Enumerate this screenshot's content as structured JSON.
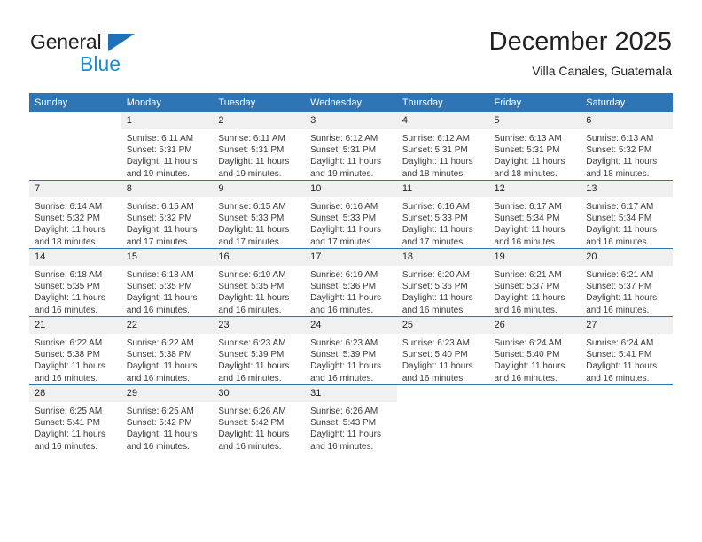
{
  "brand": {
    "name_part1": "General",
    "name_part2": "Blue",
    "triangle_icon": "triangle-icon",
    "accent_color": "#1d8bd1",
    "triangle_color": "#1d71b8"
  },
  "header": {
    "title": "December 2025",
    "subtitle": "Villa Canales, Guatemala"
  },
  "theme": {
    "header_row_bg": "#2e75b6",
    "daynum_bg": "#f0f0f0",
    "row_rule": "#2e75b6",
    "text": "#231f20"
  },
  "columns": [
    "Sunday",
    "Monday",
    "Tuesday",
    "Wednesday",
    "Thursday",
    "Friday",
    "Saturday"
  ],
  "weeks": [
    [
      {
        "day": "",
        "sunrise": "",
        "sunset": "",
        "daylight": "",
        "empty": true
      },
      {
        "day": "1",
        "sunrise": "Sunrise: 6:11 AM",
        "sunset": "Sunset: 5:31 PM",
        "daylight": "Daylight: 11 hours and 19 minutes."
      },
      {
        "day": "2",
        "sunrise": "Sunrise: 6:11 AM",
        "sunset": "Sunset: 5:31 PM",
        "daylight": "Daylight: 11 hours and 19 minutes."
      },
      {
        "day": "3",
        "sunrise": "Sunrise: 6:12 AM",
        "sunset": "Sunset: 5:31 PM",
        "daylight": "Daylight: 11 hours and 19 minutes."
      },
      {
        "day": "4",
        "sunrise": "Sunrise: 6:12 AM",
        "sunset": "Sunset: 5:31 PM",
        "daylight": "Daylight: 11 hours and 18 minutes."
      },
      {
        "day": "5",
        "sunrise": "Sunrise: 6:13 AM",
        "sunset": "Sunset: 5:31 PM",
        "daylight": "Daylight: 11 hours and 18 minutes."
      },
      {
        "day": "6",
        "sunrise": "Sunrise: 6:13 AM",
        "sunset": "Sunset: 5:32 PM",
        "daylight": "Daylight: 11 hours and 18 minutes."
      }
    ],
    [
      {
        "day": "7",
        "sunrise": "Sunrise: 6:14 AM",
        "sunset": "Sunset: 5:32 PM",
        "daylight": "Daylight: 11 hours and 18 minutes."
      },
      {
        "day": "8",
        "sunrise": "Sunrise: 6:15 AM",
        "sunset": "Sunset: 5:32 PM",
        "daylight": "Daylight: 11 hours and 17 minutes."
      },
      {
        "day": "9",
        "sunrise": "Sunrise: 6:15 AM",
        "sunset": "Sunset: 5:33 PM",
        "daylight": "Daylight: 11 hours and 17 minutes."
      },
      {
        "day": "10",
        "sunrise": "Sunrise: 6:16 AM",
        "sunset": "Sunset: 5:33 PM",
        "daylight": "Daylight: 11 hours and 17 minutes."
      },
      {
        "day": "11",
        "sunrise": "Sunrise: 6:16 AM",
        "sunset": "Sunset: 5:33 PM",
        "daylight": "Daylight: 11 hours and 17 minutes."
      },
      {
        "day": "12",
        "sunrise": "Sunrise: 6:17 AM",
        "sunset": "Sunset: 5:34 PM",
        "daylight": "Daylight: 11 hours and 16 minutes."
      },
      {
        "day": "13",
        "sunrise": "Sunrise: 6:17 AM",
        "sunset": "Sunset: 5:34 PM",
        "daylight": "Daylight: 11 hours and 16 minutes."
      }
    ],
    [
      {
        "day": "14",
        "sunrise": "Sunrise: 6:18 AM",
        "sunset": "Sunset: 5:35 PM",
        "daylight": "Daylight: 11 hours and 16 minutes."
      },
      {
        "day": "15",
        "sunrise": "Sunrise: 6:18 AM",
        "sunset": "Sunset: 5:35 PM",
        "daylight": "Daylight: 11 hours and 16 minutes."
      },
      {
        "day": "16",
        "sunrise": "Sunrise: 6:19 AM",
        "sunset": "Sunset: 5:35 PM",
        "daylight": "Daylight: 11 hours and 16 minutes."
      },
      {
        "day": "17",
        "sunrise": "Sunrise: 6:19 AM",
        "sunset": "Sunset: 5:36 PM",
        "daylight": "Daylight: 11 hours and 16 minutes."
      },
      {
        "day": "18",
        "sunrise": "Sunrise: 6:20 AM",
        "sunset": "Sunset: 5:36 PM",
        "daylight": "Daylight: 11 hours and 16 minutes."
      },
      {
        "day": "19",
        "sunrise": "Sunrise: 6:21 AM",
        "sunset": "Sunset: 5:37 PM",
        "daylight": "Daylight: 11 hours and 16 minutes."
      },
      {
        "day": "20",
        "sunrise": "Sunrise: 6:21 AM",
        "sunset": "Sunset: 5:37 PM",
        "daylight": "Daylight: 11 hours and 16 minutes."
      }
    ],
    [
      {
        "day": "21",
        "sunrise": "Sunrise: 6:22 AM",
        "sunset": "Sunset: 5:38 PM",
        "daylight": "Daylight: 11 hours and 16 minutes."
      },
      {
        "day": "22",
        "sunrise": "Sunrise: 6:22 AM",
        "sunset": "Sunset: 5:38 PM",
        "daylight": "Daylight: 11 hours and 16 minutes."
      },
      {
        "day": "23",
        "sunrise": "Sunrise: 6:23 AM",
        "sunset": "Sunset: 5:39 PM",
        "daylight": "Daylight: 11 hours and 16 minutes."
      },
      {
        "day": "24",
        "sunrise": "Sunrise: 6:23 AM",
        "sunset": "Sunset: 5:39 PM",
        "daylight": "Daylight: 11 hours and 16 minutes."
      },
      {
        "day": "25",
        "sunrise": "Sunrise: 6:23 AM",
        "sunset": "Sunset: 5:40 PM",
        "daylight": "Daylight: 11 hours and 16 minutes."
      },
      {
        "day": "26",
        "sunrise": "Sunrise: 6:24 AM",
        "sunset": "Sunset: 5:40 PM",
        "daylight": "Daylight: 11 hours and 16 minutes."
      },
      {
        "day": "27",
        "sunrise": "Sunrise: 6:24 AM",
        "sunset": "Sunset: 5:41 PM",
        "daylight": "Daylight: 11 hours and 16 minutes."
      }
    ],
    [
      {
        "day": "28",
        "sunrise": "Sunrise: 6:25 AM",
        "sunset": "Sunset: 5:41 PM",
        "daylight": "Daylight: 11 hours and 16 minutes."
      },
      {
        "day": "29",
        "sunrise": "Sunrise: 6:25 AM",
        "sunset": "Sunset: 5:42 PM",
        "daylight": "Daylight: 11 hours and 16 minutes."
      },
      {
        "day": "30",
        "sunrise": "Sunrise: 6:26 AM",
        "sunset": "Sunset: 5:42 PM",
        "daylight": "Daylight: 11 hours and 16 minutes."
      },
      {
        "day": "31",
        "sunrise": "Sunrise: 6:26 AM",
        "sunset": "Sunset: 5:43 PM",
        "daylight": "Daylight: 11 hours and 16 minutes."
      },
      {
        "day": "",
        "sunrise": "",
        "sunset": "",
        "daylight": "",
        "empty": true
      },
      {
        "day": "",
        "sunrise": "",
        "sunset": "",
        "daylight": "",
        "empty": true
      },
      {
        "day": "",
        "sunrise": "",
        "sunset": "",
        "daylight": "",
        "empty": true
      }
    ]
  ]
}
